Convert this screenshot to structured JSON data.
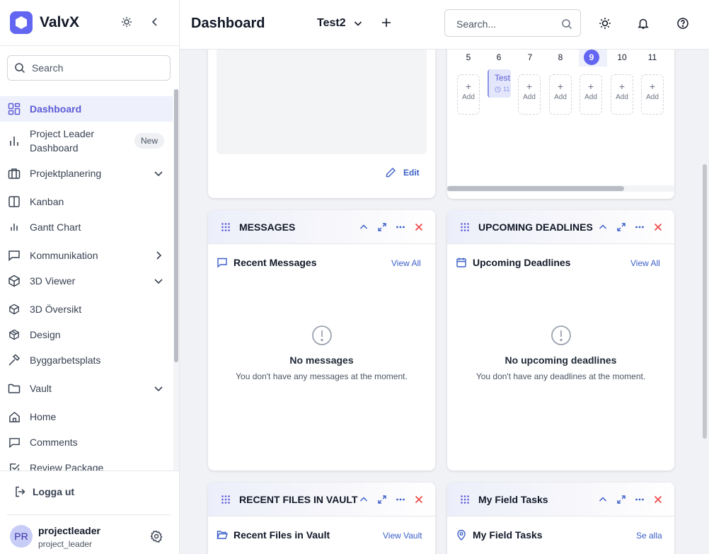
{
  "app": {
    "name": "ValvX"
  },
  "sidebar": {
    "search_placeholder": "Search",
    "items": [
      {
        "label": "Dashboard",
        "icon": "dashboard-grid-icon",
        "active": true
      },
      {
        "label": "Project Leader",
        "label2": "Dashboard",
        "icon": "bar-chart-icon",
        "badge": "New"
      },
      {
        "label": "Projektplanering",
        "icon": "briefcase-icon",
        "expand": "down"
      },
      {
        "label": "Kanban",
        "icon": "kanban-icon"
      },
      {
        "label": "Gantt Chart",
        "icon": "gantt-bars-icon"
      },
      {
        "label": "Kommunikation",
        "icon": "chat-bubble-icon",
        "expand": "right"
      },
      {
        "label": "3D Viewer",
        "icon": "cube-icon",
        "expand": "down"
      },
      {
        "label": "3D Översikt",
        "icon": "cube-small-icon"
      },
      {
        "label": "Design",
        "icon": "box-icon"
      },
      {
        "label": "Byggarbetsplats",
        "icon": "hammer-icon"
      },
      {
        "label": "Vault",
        "icon": "folder-icon",
        "expand": "down"
      },
      {
        "label": "Home",
        "icon": "home-icon"
      },
      {
        "label": "Comments",
        "icon": "comment-icon"
      },
      {
        "label": "Review Package",
        "icon": "check-square-icon"
      }
    ],
    "logout_label": "Logga ut",
    "user": {
      "initials": "PR",
      "name": "projectleader",
      "handle": "project_leader"
    }
  },
  "topbar": {
    "title": "Dashboard",
    "project": "Test2",
    "search_placeholder": "Search..."
  },
  "widgets": {
    "notes": {
      "edit_label": "Edit"
    },
    "calendar": {
      "days": [
        "5",
        "6",
        "7",
        "8",
        "9",
        "10",
        "11"
      ],
      "today": "9",
      "event_title": "Test",
      "event_time": "11",
      "add_label": "Add"
    },
    "messages": {
      "title": "MESSAGES",
      "subtitle": "Recent Messages",
      "link": "View All",
      "empty_title": "No messages",
      "empty_text": "You don't have any messages at the moment."
    },
    "deadlines": {
      "title": "UPCOMING DEADLINES",
      "subtitle": "Upcoming Deadlines",
      "link": "View All",
      "empty_title": "No upcoming deadlines",
      "empty_text": "You don't have any deadlines at the moment."
    },
    "files": {
      "title": "RECENT FILES IN VAULT",
      "subtitle": "Recent Files in Vault",
      "link": "View Vault"
    },
    "field_tasks": {
      "title": "My Field Tasks",
      "subtitle": "My Field Tasks",
      "link": "Se alla"
    }
  },
  "colors": {
    "accent": "#6366f1",
    "link": "#3b5fc7",
    "close": "#ef4444"
  }
}
